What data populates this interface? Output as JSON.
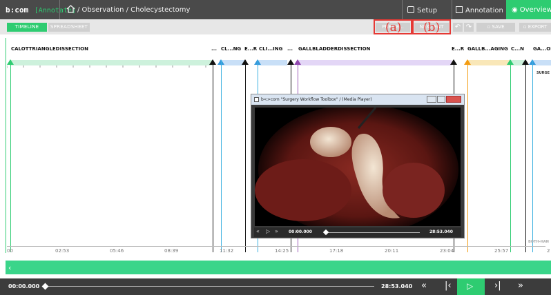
{
  "header": {
    "brand": "b:com",
    "brand_tag": "[Annotate]",
    "breadcrumb": "/ Observation / Cholecystectomy",
    "nav": {
      "setup": "Setup",
      "annotation": "Annotation",
      "overview": "Overview"
    }
  },
  "toolbar": {
    "tabs": {
      "timeline": "TIMELINE",
      "spreadsheet": "SPREADSHEET"
    },
    "prev_event": "PREV E...",
    "next_event": "NEXT ENT",
    "save": "SAVE",
    "export": "EXPORT",
    "callouts": {
      "a": "(a)",
      "b": "(b)"
    }
  },
  "phases": {
    "labels": [
      "CALOTTRIANGLEDISSECTION",
      "...",
      "CL...NG",
      "E...R",
      "CLI...ING",
      "...",
      "GALLBLADDERDISSECTION",
      "E...R",
      "GALLB...AGING",
      "C...N",
      "GA...ON"
    ]
  },
  "axis_ticks": [
    "00",
    "02:53",
    "05:46",
    "08:39",
    "11:32",
    "14:25",
    "17:18",
    "20:11",
    "23:04",
    "25:57",
    "2"
  ],
  "side_labels": {
    "surgeon": "SURGE",
    "both_hands": "BOTH-HAN"
  },
  "player": {
    "title": "b<>com \"Surgery Workflow Toolbox\" / (Media Player)",
    "current_time": "00:00.000",
    "total_time": "28:53.040",
    "position": 0.0
  },
  "bottom": {
    "current_time": "00:00.000",
    "total_time": "28:53.040",
    "position": 0.0
  },
  "colors": {
    "accent": "#2ecc71",
    "header": "#4a4a4a",
    "callout": "#e53935"
  }
}
